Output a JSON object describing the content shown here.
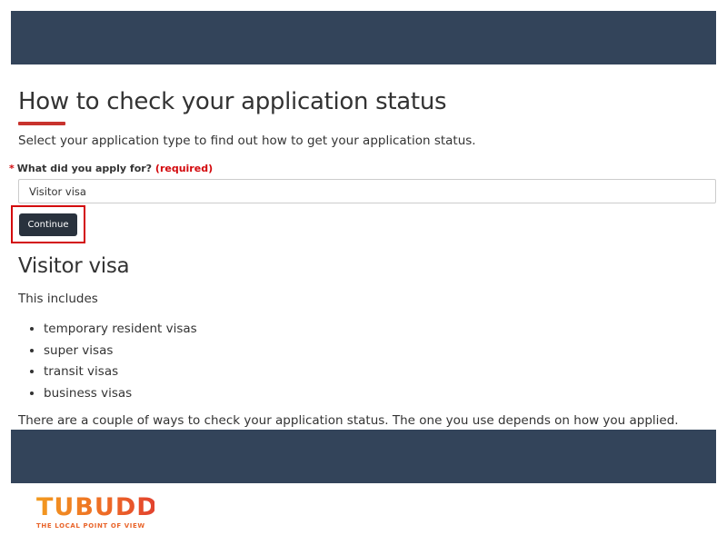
{
  "page": {
    "title": "How to check your application status",
    "intro": "Select your application type to find out how to get your application status."
  },
  "form": {
    "asterisk": "*",
    "label": "What did you apply for?",
    "required": "(required)",
    "selected_value": "Visitor visa",
    "continue_label": "Continue"
  },
  "section": {
    "title": "Visitor visa",
    "includes": "This includes",
    "items": [
      "temporary resident visas",
      "super visas",
      "transit visas",
      "business visas"
    ],
    "ways": "There are a couple of ways to check your application status. The one you use depends on how you applied."
  },
  "logo": {
    "word": "TUBUDD",
    "tagline": "THE LOCAL POINT OF VIEW"
  },
  "colors": {
    "banner": "#33445a",
    "accent_red": "#d3080c",
    "title_underline": "#c8332e",
    "button": "#29323d",
    "logo_orange": "#ee6a26"
  }
}
